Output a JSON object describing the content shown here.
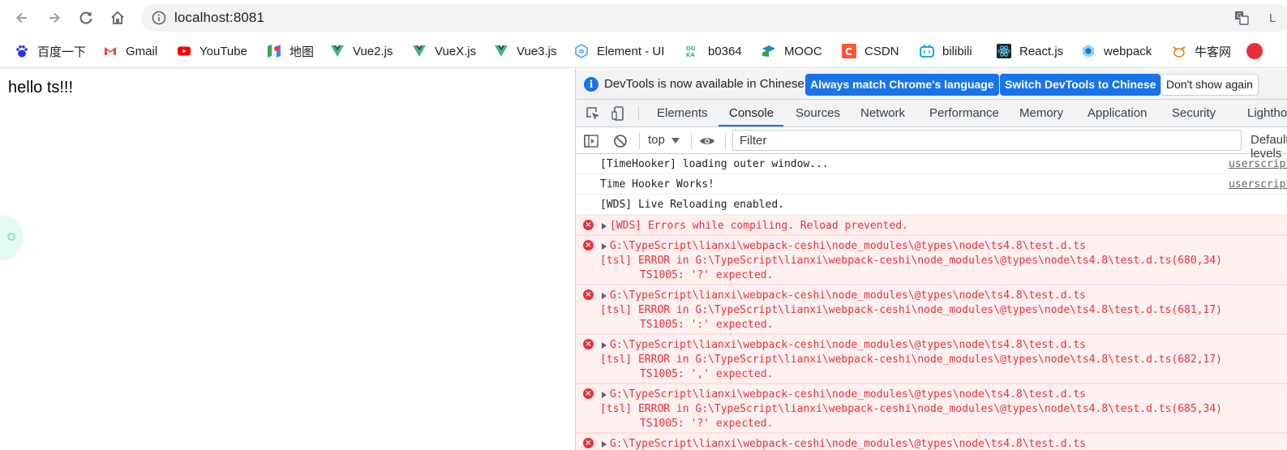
{
  "browser": {
    "url": "localhost:8081",
    "bookmarks": [
      {
        "label": "百度一下",
        "icon": "baidu-icon",
        "color": "#2932e1"
      },
      {
        "label": "Gmail",
        "icon": "gmail-icon",
        "color": "#ea4335"
      },
      {
        "label": "YouTube",
        "icon": "youtube-icon",
        "color": "#ff0000"
      },
      {
        "label": "地图",
        "icon": "maps-icon",
        "color": "#34a853"
      },
      {
        "label": "Vue2.js",
        "icon": "vue-icon",
        "color": "#41b883"
      },
      {
        "label": "VueX.js",
        "icon": "vue-icon",
        "color": "#41b883"
      },
      {
        "label": "Vue3.js",
        "icon": "vue-icon",
        "color": "#41b883"
      },
      {
        "label": "Element - UI",
        "icon": "element-icon",
        "color": "#409eff"
      },
      {
        "label": "b0364",
        "icon": "dukan-icon",
        "color": "#3cb371"
      },
      {
        "label": "MOOC",
        "icon": "mooc-icon",
        "color": "#1e8bc3"
      },
      {
        "label": "CSDN",
        "icon": "csdn-icon",
        "color": "#fc5531"
      },
      {
        "label": "bilibili",
        "icon": "bilibili-icon",
        "color": "#00a1d6"
      },
      {
        "label": "React.js",
        "icon": "react-icon",
        "color": "#087ea4"
      },
      {
        "label": "webpack",
        "icon": "webpack-icon",
        "color": "#8dd6f9"
      },
      {
        "label": "牛客网",
        "icon": "nowcoder-icon",
        "color": "#25bb9b"
      }
    ]
  },
  "page": {
    "text": "hello ts!!!"
  },
  "devtools": {
    "infobar": {
      "message": "DevTools is now available in Chinese!",
      "btn_match": "Always match Chrome's language",
      "btn_switch": "Switch DevTools to Chinese",
      "btn_dismiss": "Don't show again"
    },
    "tabs": [
      "Elements",
      "Console",
      "Sources",
      "Network",
      "Performance",
      "Memory",
      "Application",
      "Security",
      "Lighthouse"
    ],
    "active_tab": "Console",
    "console_toolbar": {
      "context": "top",
      "filter_placeholder": "Filter",
      "levels": "Default levels"
    },
    "logs": [
      {
        "text": "[TimeHooker] loading outer window...",
        "source": "userscript"
      },
      {
        "text": "Time Hooker Works!",
        "source": "userscript"
      },
      {
        "text": "[WDS] Live Reloading enabled.",
        "source": ""
      }
    ],
    "errors": [
      {
        "summary": "[WDS] Errors while compiling. Reload prevented."
      },
      {
        "summary": "G:\\TypeScript\\lianxi\\webpack-ceshi\\node_modules\\@types\\node\\ts4.8\\test.d.ts",
        "detail": "[tsl] ERROR in G:\\TypeScript\\lianxi\\webpack-ceshi\\node_modules\\@types\\node\\ts4.8\\test.d.ts(680,34)",
        "code": "TS1005: '?' expected."
      },
      {
        "summary": "G:\\TypeScript\\lianxi\\webpack-ceshi\\node_modules\\@types\\node\\ts4.8\\test.d.ts",
        "detail": "[tsl] ERROR in G:\\TypeScript\\lianxi\\webpack-ceshi\\node_modules\\@types\\node\\ts4.8\\test.d.ts(681,17)",
        "code": "TS1005: ':' expected."
      },
      {
        "summary": "G:\\TypeScript\\lianxi\\webpack-ceshi\\node_modules\\@types\\node\\ts4.8\\test.d.ts",
        "detail": "[tsl] ERROR in G:\\TypeScript\\lianxi\\webpack-ceshi\\node_modules\\@types\\node\\ts4.8\\test.d.ts(682,17)",
        "code": "TS1005: ',' expected."
      },
      {
        "summary": "G:\\TypeScript\\lianxi\\webpack-ceshi\\node_modules\\@types\\node\\ts4.8\\test.d.ts",
        "detail": "[tsl] ERROR in G:\\TypeScript\\lianxi\\webpack-ceshi\\node_modules\\@types\\node\\ts4.8\\test.d.ts(685,34)",
        "code": "TS1005: '?' expected."
      },
      {
        "summary": "G:\\TypeScript\\lianxi\\webpack-ceshi\\node_modules\\@types\\node\\ts4.8\\test.d.ts"
      }
    ]
  },
  "colors": {
    "accent": "#1a73e8",
    "error_text": "#e8303a",
    "error_bg": "#fff0f0"
  }
}
